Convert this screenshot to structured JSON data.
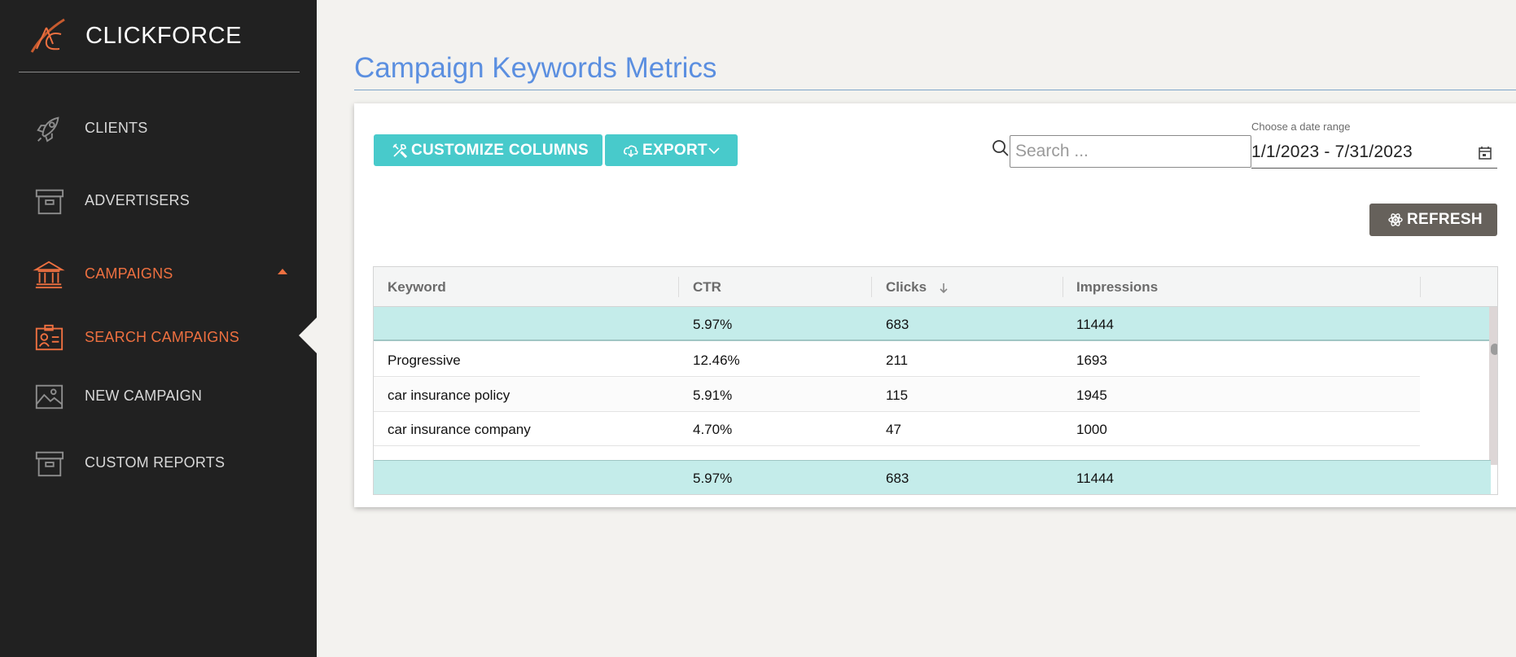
{
  "brand": {
    "name": "CLICKFORCE"
  },
  "sidebar": {
    "items": [
      {
        "label": "CLIENTS",
        "icon": "rocket-icon"
      },
      {
        "label": "ADVERTISERS",
        "icon": "archive-box-icon"
      },
      {
        "label": "CAMPAIGNS",
        "icon": "bank-icon",
        "active": true
      },
      {
        "label": "SEARCH CAMPAIGNS",
        "icon": "id-card-icon",
        "active": true
      },
      {
        "label": "NEW CAMPAIGN",
        "icon": "image-icon"
      },
      {
        "label": "CUSTOM REPORTS",
        "icon": "archive-box-icon"
      }
    ]
  },
  "page": {
    "title": "Campaign Keywords Metrics"
  },
  "toolbar": {
    "customize_label": "CUSTOMIZE COLUMNS",
    "export_label": "EXPORT",
    "search_placeholder": "Search ...",
    "date_label": "Choose a date range",
    "date_value": "1/1/2023 - 7/31/2023",
    "refresh_label": "REFRESH"
  },
  "table": {
    "headers": [
      "Keyword",
      "CTR",
      "Clicks",
      "Impressions"
    ],
    "sorted_column": "Clicks",
    "sort_direction": "desc",
    "summary_top": {
      "keyword": "",
      "ctr": "5.97%",
      "clicks": "683",
      "impressions": "11444"
    },
    "rows": [
      {
        "keyword": "Progressive",
        "ctr": "12.46%",
        "clicks": "211",
        "impressions": "1693"
      },
      {
        "keyword": "car insurance policy",
        "ctr": "5.91%",
        "clicks": "115",
        "impressions": "1945"
      },
      {
        "keyword": "car insurance company",
        "ctr": "4.70%",
        "clicks": "47",
        "impressions": "1000"
      }
    ],
    "summary_bottom": {
      "keyword": "",
      "ctr": "5.97%",
      "clicks": "683",
      "impressions": "11444"
    }
  },
  "colors": {
    "sidebar_bg": "#212121",
    "accent_orange": "#ee7040",
    "title_blue": "#5b8fe0",
    "teal_button": "#48cacb",
    "summary_row": "#c4ecea",
    "refresh_button": "#66615b"
  }
}
